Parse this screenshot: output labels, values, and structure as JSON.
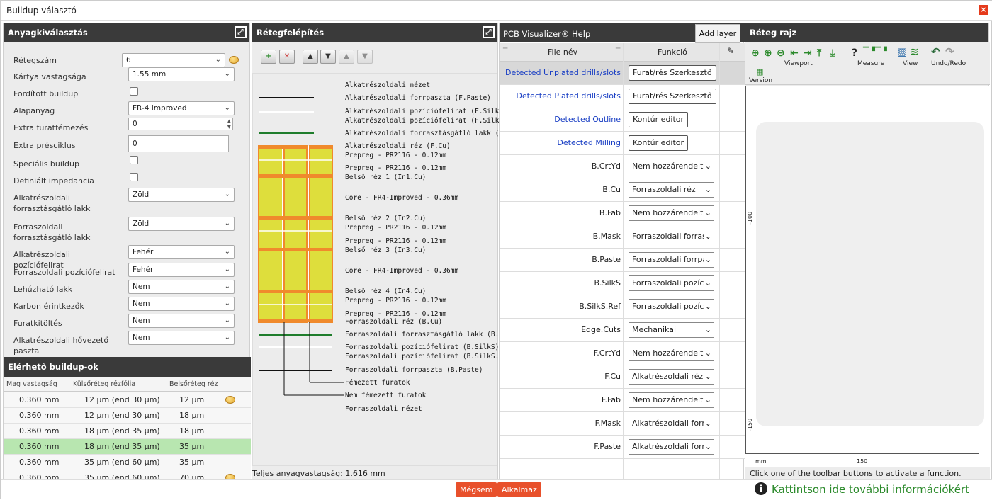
{
  "window": {
    "title": "Buildup választó"
  },
  "panel1": {
    "title": "Anyagkiválasztás",
    "fields": {
      "layers": {
        "label": "Rétegszám",
        "value": "6"
      },
      "thickness": {
        "label": "Kártya vastagsága",
        "value": "1.55 mm"
      },
      "reversed": {
        "label": "Fordított buildup"
      },
      "material": {
        "label": "Alapanyag",
        "value": "FR-4 Improved"
      },
      "extra_plating": {
        "label": "Extra furatfémezés",
        "value": "0"
      },
      "extra_press": {
        "label": "Extra présciklus",
        "value": "0"
      },
      "special": {
        "label": "Speciális buildup"
      },
      "impedance": {
        "label": "Definiált impedancia"
      },
      "top_mask": {
        "label": "Alkatrészoldali forrasztásgátló lakk",
        "value": "Zöld"
      },
      "bottom_mask": {
        "label": "Forraszoldali forrasztásgátló lakk",
        "value": "Zöld"
      },
      "top_silk": {
        "label": "Alkatrészoldali pozíciófelirat",
        "value": "Fehér"
      },
      "bottom_silk": {
        "label": "Forraszoldali pozíciófelirat",
        "value": "Fehér"
      },
      "peelable": {
        "label": "Lehúzható lakk",
        "value": "Nem"
      },
      "carbon": {
        "label": "Karbon érintkezők",
        "value": "Nem"
      },
      "via_fill": {
        "label": "Furatkitöltés",
        "value": "Nem"
      },
      "thermal_paste": {
        "label": "Alkatrészoldali hővezető paszta",
        "value": "Nem"
      }
    }
  },
  "buildups": {
    "title": "Elérhető buildup-ok",
    "columns": [
      "Mag vastagság",
      "Külsőréteg rézfólia",
      "Belsőréteg réz"
    ],
    "rows": [
      {
        "core": "0.360 mm",
        "outer": "12 µm (end 30 µm)",
        "inner": "12 µm"
      },
      {
        "core": "0.360 mm",
        "outer": "12 µm (end 30 µm)",
        "inner": "18 µm"
      },
      {
        "core": "0.360 mm",
        "outer": "18 µm (end 35 µm)",
        "inner": "18 µm"
      },
      {
        "core": "0.360 mm",
        "outer": "18 µm (end 35 µm)",
        "inner": "35 µm"
      },
      {
        "core": "0.360 mm",
        "outer": "35 µm (end 60 µm)",
        "inner": "35 µm"
      },
      {
        "core": "0.360 mm",
        "outer": "35 µm (end 60 µm)",
        "inner": "70 µm"
      }
    ]
  },
  "panel2": {
    "title": "Rétegfelépítés",
    "toolbar": {
      "add": "+",
      "delete": "✕",
      "up": "▲",
      "down": "▼",
      "up_disabled": "▲",
      "down_disabled": "▼"
    },
    "layers": [
      "Alkatrészoldali nézet",
      "Alkatrészoldali forrpaszta (F.Paste)",
      "Alkatrészoldali pozíciófelirat (F.SilkS)",
      "Alkatrészoldali pozíciófelirat (F.SilkS.Ref)",
      "Alkatrészoldali forrasztásgátló lakk (F.Mask)",
      "Alkatrészoldali réz (F.Cu)",
      "Prepreg - PR2116 - 0.12mm",
      "Prepreg - PR2116 - 0.12mm",
      "Belső réz 1 (In1.Cu)",
      "Core - FR4-Improved - 0.36mm",
      "Belső réz 2 (In2.Cu)",
      "Prepreg - PR2116 - 0.12mm",
      "Prepreg - PR2116 - 0.12mm",
      "Belső réz 3 (In3.Cu)",
      "Core - FR4-Improved - 0.36mm",
      "Belső réz 4 (In4.Cu)",
      "Prepreg - PR2116 - 0.12mm",
      "Prepreg - PR2116 - 0.12mm",
      "Forraszoldali réz (B.Cu)",
      "Forraszoldali forrasztásgátló lakk (B.Mask)",
      "Forraszoldali pozíciófelirat (B.SilkS)",
      "Forraszoldali pozíciófelirat (B.SilkS.Ref)",
      "Forraszoldali forrpaszta (B.Paste)",
      "Fémezett furatok",
      "Nem fémezett furatok",
      "Forraszoldali nézet"
    ],
    "total": "Teljes anyagvastagság: 1.616 mm"
  },
  "panel3": {
    "title": "PCB Visualizer® Help",
    "add_layer": "Add layer",
    "col_file": "File név",
    "col_func": "Funkció",
    "rows": [
      {
        "file": "Detected Unplated drills/slots",
        "func": "Furat/rés Szerkesztő",
        "kind": "button",
        "blue": true
      },
      {
        "file": "Detected Plated drills/slots",
        "func": "Furat/rés Szerkesztő",
        "kind": "button",
        "blue": true
      },
      {
        "file": "Detected Outline",
        "func": "Kontúr editor",
        "kind": "button",
        "blue": true
      },
      {
        "file": "Detected Milling",
        "func": "Kontúr editor",
        "kind": "button",
        "blue": true
      },
      {
        "file": "B.CrtYd",
        "func": "Nem hozzárendelt",
        "kind": "select"
      },
      {
        "file": "B.Cu",
        "func": "Forraszoldali réz",
        "kind": "select"
      },
      {
        "file": "B.Fab",
        "func": "Nem hozzárendelt",
        "kind": "select"
      },
      {
        "file": "B.Mask",
        "func": "Forraszoldali forras",
        "kind": "select"
      },
      {
        "file": "B.Paste",
        "func": "Forraszoldali forrpa",
        "kind": "select"
      },
      {
        "file": "B.SilkS",
        "func": "Forraszoldali pozíci",
        "kind": "select"
      },
      {
        "file": "B.SilkS.Ref",
        "func": "Forraszoldali pozíci",
        "kind": "select"
      },
      {
        "file": "Edge.Cuts",
        "func": "Mechanikai",
        "kind": "select"
      },
      {
        "file": "F.CrtYd",
        "func": "Nem hozzárendelt",
        "kind": "select"
      },
      {
        "file": "F.Cu",
        "func": "Alkatrészoldali réz",
        "kind": "select"
      },
      {
        "file": "F.Fab",
        "func": "Nem hozzárendelt",
        "kind": "select"
      },
      {
        "file": "F.Mask",
        "func": "Alkatrészoldali forra",
        "kind": "select"
      },
      {
        "file": "F.Paste",
        "func": "Alkatrészoldali forrp",
        "kind": "select"
      }
    ]
  },
  "panel4": {
    "title": "Réteg rajz",
    "groups": {
      "viewport": "Viewport",
      "measure": "Measure",
      "view": "View",
      "undo": "Undo/Redo",
      "version": "Version"
    },
    "ruler": {
      "y1": "-100",
      "y2": "-150",
      "x_unit": "mm",
      "x1": "150"
    },
    "status": "Click one of the toolbar buttons to activate a function."
  },
  "footer": {
    "cancel": "Mégsem",
    "apply": "Alkalmaz",
    "info": "Kattintson ide további információkért"
  },
  "colors": {
    "accent": "#e8502b",
    "header": "#3a3a3a",
    "link": "#1a3fc4",
    "green": "#2b8a2b",
    "copper": "#f08a2c",
    "core": "#dede3c"
  }
}
